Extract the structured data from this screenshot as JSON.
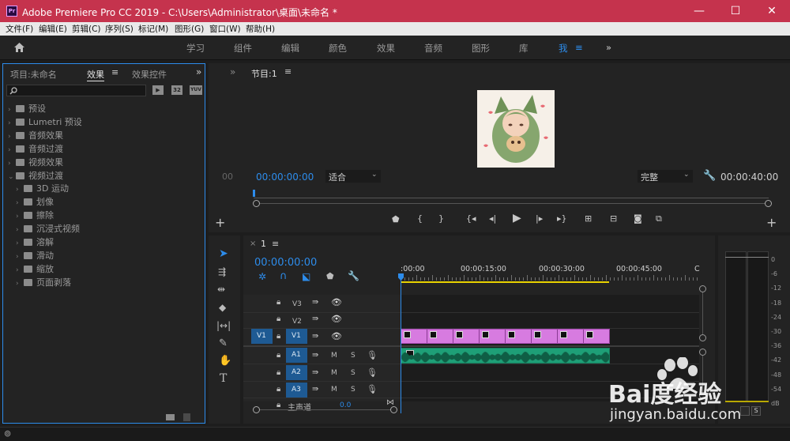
{
  "window": {
    "title": "Adobe Premiere Pro CC 2019 - C:\\Users\\Administrator\\桌面\\未命名 *",
    "app_icon": "Pr",
    "controls": [
      "—",
      "☐",
      "✕"
    ]
  },
  "menu": [
    "文件(F)",
    "编辑(E)",
    "剪辑(C)",
    "序列(S)",
    "标记(M)",
    "图形(G)",
    "窗口(W)",
    "帮助(H)"
  ],
  "workspaces": {
    "items": [
      "学习",
      "组件",
      "编辑",
      "颜色",
      "效果",
      "音频",
      "图形",
      "库",
      "我"
    ],
    "active_index": 8,
    "more": "»"
  },
  "effects_panel": {
    "tabs": [
      "项目:未命名",
      "效果",
      "效果控件"
    ],
    "active_tab": 1,
    "search_placeholder": "",
    "filter_buttons": [
      "加速",
      "32",
      "YUV"
    ],
    "tree": [
      {
        "label": "预设",
        "level": 0,
        "expanded": false,
        "icon": "preset-folder"
      },
      {
        "label": "Lumetri 预设",
        "level": 0,
        "expanded": false,
        "icon": "preset-folder"
      },
      {
        "label": "音频效果",
        "level": 0,
        "expanded": false,
        "icon": "folder"
      },
      {
        "label": "音频过渡",
        "level": 0,
        "expanded": false,
        "icon": "folder"
      },
      {
        "label": "视频效果",
        "level": 0,
        "expanded": false,
        "icon": "folder"
      },
      {
        "label": "视频过渡",
        "level": 0,
        "expanded": true,
        "icon": "folder"
      },
      {
        "label": "3D 运动",
        "level": 1,
        "expanded": false,
        "icon": "folder"
      },
      {
        "label": "划像",
        "level": 1,
        "expanded": false,
        "icon": "folder"
      },
      {
        "label": "擦除",
        "level": 1,
        "expanded": false,
        "icon": "folder"
      },
      {
        "label": "沉浸式视频",
        "level": 1,
        "expanded": false,
        "icon": "folder"
      },
      {
        "label": "溶解",
        "level": 1,
        "expanded": false,
        "icon": "folder"
      },
      {
        "label": "滑动",
        "level": 1,
        "expanded": false,
        "icon": "folder"
      },
      {
        "label": "缩放",
        "level": 1,
        "expanded": false,
        "icon": "folder"
      },
      {
        "label": "页面剥落",
        "level": 1,
        "expanded": false,
        "icon": "folder"
      }
    ]
  },
  "program_monitor": {
    "title": "节目:1",
    "timecode_current": "00:00:00:00",
    "fit": "适合",
    "quality": "完整",
    "timecode_duration": "00:00:40:00",
    "side_time": "00"
  },
  "timeline": {
    "sequence_name": "1",
    "timecode": "00:00:00:00",
    "ruler_labels": [
      ":00:00",
      "00:00:15:00",
      "00:00:30:00",
      "00:00:45:00",
      "C"
    ],
    "video_tracks": [
      "V3",
      "V2",
      "V1"
    ],
    "audio_tracks": [
      "A1",
      "A2",
      "A3"
    ],
    "source_patch_v": "V1",
    "track_buttons": {
      "mute": "M",
      "solo": "S"
    },
    "master": {
      "label": "主声道",
      "value": "0.0"
    }
  },
  "audio_meter": {
    "scale": [
      "0",
      "-6",
      "-12",
      "-18",
      "-24",
      "-30",
      "-36",
      "-42",
      "-48",
      "-54",
      "dB"
    ],
    "solo_label": "S"
  },
  "tools": [
    "selection-tool",
    "track-select-tool",
    "ripple-edit-tool",
    "razor-tool",
    "slip-tool",
    "pen-tool",
    "hand-tool",
    "type-tool"
  ],
  "colors": {
    "accent": "#2d8ceb",
    "titlebar": "#c5334d",
    "video_clip": "#d77be0",
    "audio_clip": "#1e9f77",
    "playhead": "#2d8ceb"
  },
  "watermark": {
    "line1": "Bai度经验",
    "line2": "jingyan.baidu.com"
  }
}
